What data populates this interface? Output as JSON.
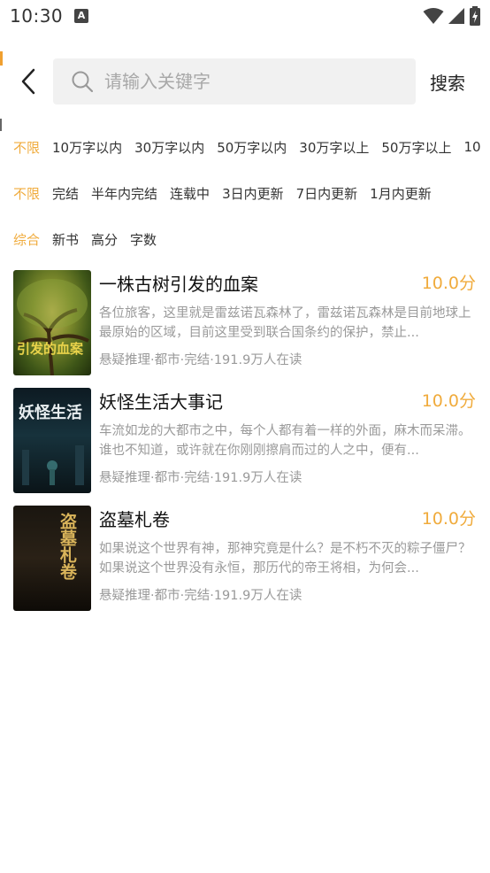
{
  "status_bar": {
    "time": "10:30",
    "notification_icon": "A",
    "icons": [
      "wifi-icon",
      "signal-icon",
      "battery-charging-icon"
    ]
  },
  "header": {
    "back_icon": "chevron-left-icon",
    "search_placeholder": "请输入关键字",
    "search_value": "",
    "search_button": "搜索"
  },
  "filters": {
    "word_count": [
      "不限",
      "10万字以内",
      "30万字以内",
      "50万字以内",
      "30万字以上",
      "50万字以上",
      "10"
    ],
    "word_count_active": 0,
    "status": [
      "不限",
      "完结",
      "半年内完结",
      "连载中",
      "3日内更新",
      "7日内更新",
      "1月内更新"
    ],
    "status_active": 0,
    "sort": [
      "综合",
      "新书",
      "高分",
      "字数"
    ],
    "sort_active": 0
  },
  "books": [
    {
      "title": "一株古树引发的血案",
      "score": "10.0分",
      "description": "各位旅客，这里就是雷兹诺瓦森林了，雷兹诺瓦森林是目前地球上最原始的区域，目前这里受到联合国条约的保护，禁止...",
      "meta": "悬疑推理·都市·完结·191.9万人在读",
      "cover_text": "引发的血案"
    },
    {
      "title": "妖怪生活大事记",
      "score": "10.0分",
      "description": "车流如龙的大都市之中，每个人都有着一样的外面，麻木而呆滞。谁也不知道，或许就在你刚刚擦肩而过的人之中，便有...",
      "meta": "悬疑推理·都市·完结·191.9万人在读",
      "cover_text": "妖怪生活"
    },
    {
      "title": "盗墓札卷",
      "score": "10.0分",
      "description": "如果说这个世界有神，那神究竟是什么？是不朽不灭的粽子僵尸？如果说这个世界没有永恒，那历代的帝王将相，为何会...",
      "meta": "悬疑推理·都市·完结·191.9万人在读",
      "cover_text": "盗墓札卷"
    }
  ],
  "colors": {
    "accent": "#f0ab3c",
    "muted_text": "#9a9a9a",
    "search_bg": "#f1f1f1"
  }
}
